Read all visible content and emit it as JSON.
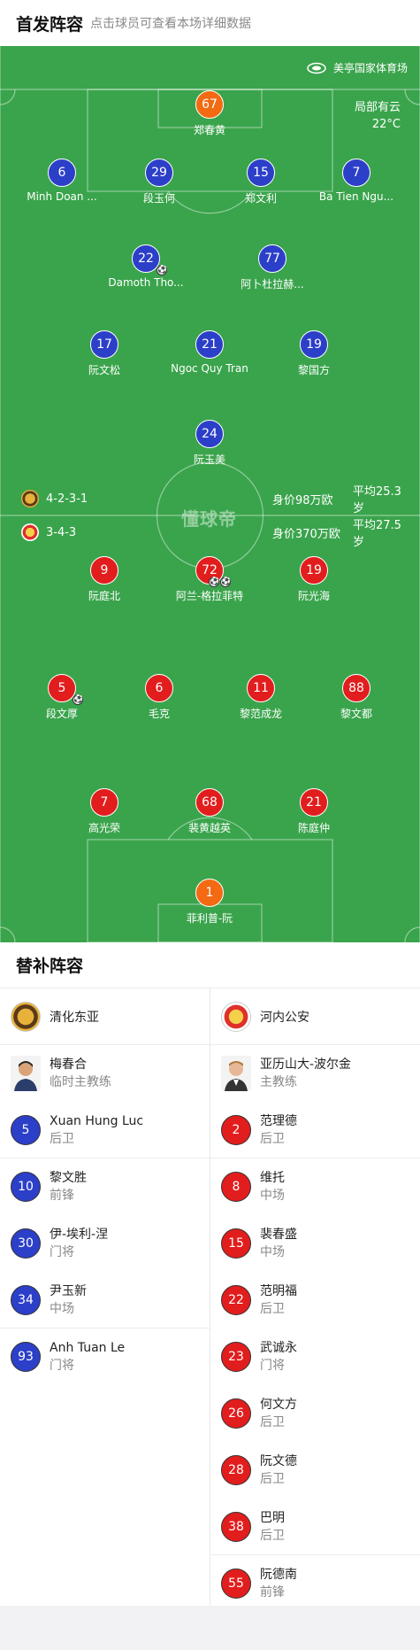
{
  "header": {
    "title": "首发阵容",
    "hint": "点击球员可查看本场详细数据"
  },
  "pitch": {
    "stadium": "美亭国家体育场",
    "weather": "局部有云",
    "temperature": "22°C",
    "watermark": "懂球帝",
    "home_team": {
      "formation": "4-2-3-1",
      "value": "身价98万欧",
      "avg_age": "平均25.3岁"
    },
    "away_team": {
      "formation": "3-4-3",
      "value": "身价370万欧",
      "avg_age": "平均27.5岁"
    },
    "home_players": [
      {
        "num": "67",
        "name": "郑春黄",
        "gk": true,
        "goals": 0
      },
      {
        "num": "6",
        "name": "Minh Doan ...",
        "goals": 0
      },
      {
        "num": "29",
        "name": "段玉何",
        "goals": 0
      },
      {
        "num": "15",
        "name": "郑文利",
        "goals": 0
      },
      {
        "num": "7",
        "name": "Ba Tien Ngu...",
        "goals": 0
      },
      {
        "num": "22",
        "name": "Damoth Tho...",
        "goals": 1
      },
      {
        "num": "77",
        "name": "阿卜杜拉赫...",
        "goals": 0
      },
      {
        "num": "17",
        "name": "阮文松",
        "goals": 0
      },
      {
        "num": "21",
        "name": "Ngoc Quy Tran",
        "goals": 0
      },
      {
        "num": "19",
        "name": "黎国方",
        "goals": 0
      },
      {
        "num": "24",
        "name": "阮玉美",
        "goals": 0
      }
    ],
    "away_players": [
      {
        "num": "9",
        "name": "阮庭北",
        "goals": 0
      },
      {
        "num": "72",
        "name": "阿兰-格拉菲特",
        "goals": 2
      },
      {
        "num": "19",
        "name": "阮光海",
        "goals": 0
      },
      {
        "num": "5",
        "name": "段文厚",
        "goals": 1
      },
      {
        "num": "6",
        "name": "毛克",
        "goals": 0
      },
      {
        "num": "11",
        "name": "黎范成龙",
        "goals": 0
      },
      {
        "num": "88",
        "name": "黎文都",
        "goals": 0
      },
      {
        "num": "7",
        "name": "高光荣",
        "goals": 0
      },
      {
        "num": "68",
        "name": "裴黄越英",
        "goals": 0
      },
      {
        "num": "21",
        "name": "陈庭仲",
        "goals": 0
      },
      {
        "num": "1",
        "name": "菲利普-阮",
        "gk": true,
        "goals": 0
      }
    ]
  },
  "subs": {
    "title": "替补阵容",
    "home": {
      "team_name": "清化东亚",
      "coach": {
        "name": "梅春合",
        "role": "临时主教练"
      },
      "players": [
        {
          "num": "5",
          "name": "Xuan Hung Luc",
          "pos": "后卫"
        },
        {
          "num": "10",
          "name": "黎文胜",
          "pos": "前锋"
        },
        {
          "num": "30",
          "name": "伊-埃利-涅",
          "pos": "门将"
        },
        {
          "num": "34",
          "name": "尹玉新",
          "pos": "中场"
        },
        {
          "num": "93",
          "name": "Anh Tuan Le",
          "pos": "门将"
        }
      ]
    },
    "away": {
      "team_name": "河内公安",
      "coach": {
        "name": "亚历山大-波尔金",
        "role": "主教练"
      },
      "players": [
        {
          "num": "2",
          "name": "范理德",
          "pos": "后卫"
        },
        {
          "num": "8",
          "name": "维托",
          "pos": "中场"
        },
        {
          "num": "15",
          "name": "裴春盛",
          "pos": "中场"
        },
        {
          "num": "22",
          "name": "范明福",
          "pos": "后卫"
        },
        {
          "num": "23",
          "name": "武诚永",
          "pos": "门将"
        },
        {
          "num": "26",
          "name": "何文方",
          "pos": "后卫"
        },
        {
          "num": "28",
          "name": "阮文德",
          "pos": "后卫"
        },
        {
          "num": "38",
          "name": "巴明",
          "pos": "后卫"
        },
        {
          "num": "55",
          "name": "阮德南",
          "pos": "前锋"
        }
      ]
    }
  },
  "colors": {
    "home": "#2c3fc9",
    "away": "#e21d1d",
    "goalkeeper": "#f36a12",
    "pitch": "#3aa44c"
  }
}
